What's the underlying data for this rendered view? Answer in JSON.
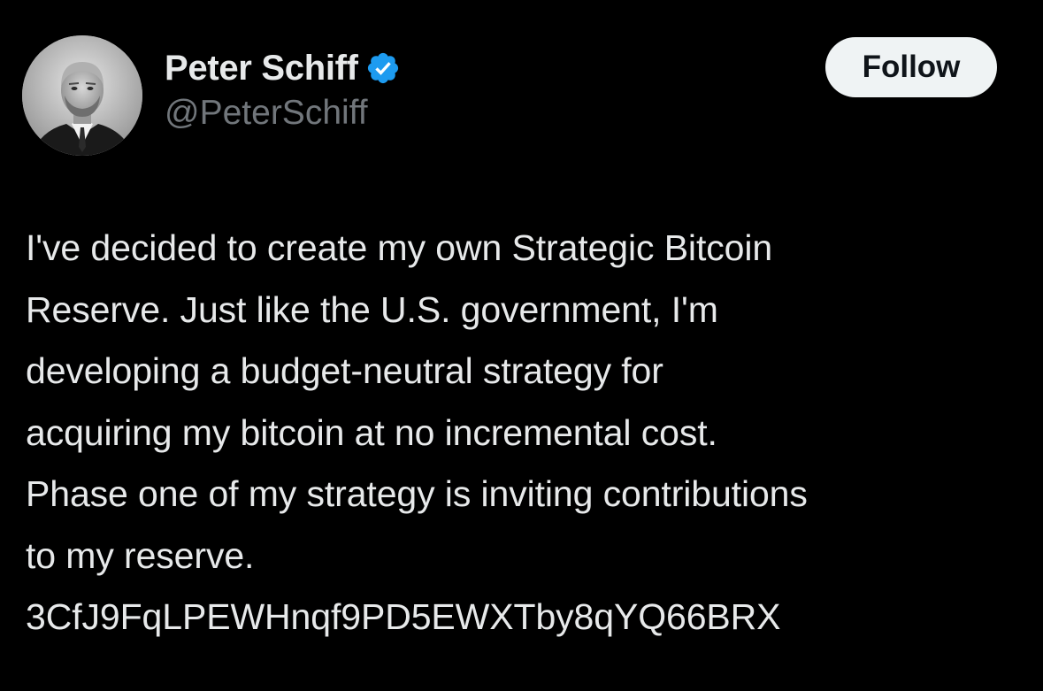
{
  "author": {
    "display_name": "Peter Schiff",
    "handle": "@PeterSchiff",
    "verified": true,
    "verified_color": "#1d9bf0"
  },
  "actions": {
    "follow_label": "Follow"
  },
  "tweet": {
    "lines": [
      "I've decided to create my own Strategic Bitcoin",
      "Reserve. Just like the U.S. government, I'm",
      "developing a budget-neutral strategy for",
      "acquiring my bitcoin at no incremental cost.",
      "Phase one of my strategy is inviting contributions",
      "to my reserve.",
      "3CfJ9FqLPEWHnqf9PD5EWXTby8qYQ66BRX"
    ]
  },
  "theme": {
    "background": "#000000",
    "text_primary": "#e7e9ea",
    "text_secondary": "#71767b",
    "button_bg": "#eff3f4"
  }
}
